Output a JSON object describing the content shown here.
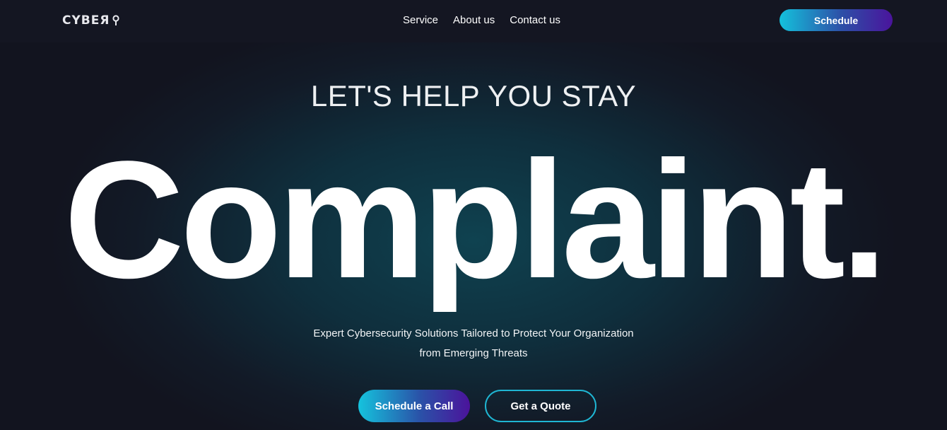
{
  "navbar": {
    "logo_text": "CYBEЯ",
    "links": [
      {
        "label": "Service"
      },
      {
        "label": "About us"
      },
      {
        "label": "Contact us"
      }
    ],
    "schedule_label": "Schedule"
  },
  "hero": {
    "tagline": "LET'S HELP YOU STAY",
    "headline": "Complaint.",
    "subtitle_line1": "Expert Cybersecurity Solutions Tailored to Protect Your Organization",
    "subtitle_line2": "from Emerging Threats",
    "primary_cta": "Schedule a Call",
    "secondary_cta": "Get a Quote"
  },
  "colors": {
    "background": "#12141f",
    "gradient_start": "#14c1dc",
    "gradient_end": "#4a149c",
    "outline_accent": "#1fb6d3"
  },
  "icons": {
    "logo_mark": "location-pin-icon"
  }
}
